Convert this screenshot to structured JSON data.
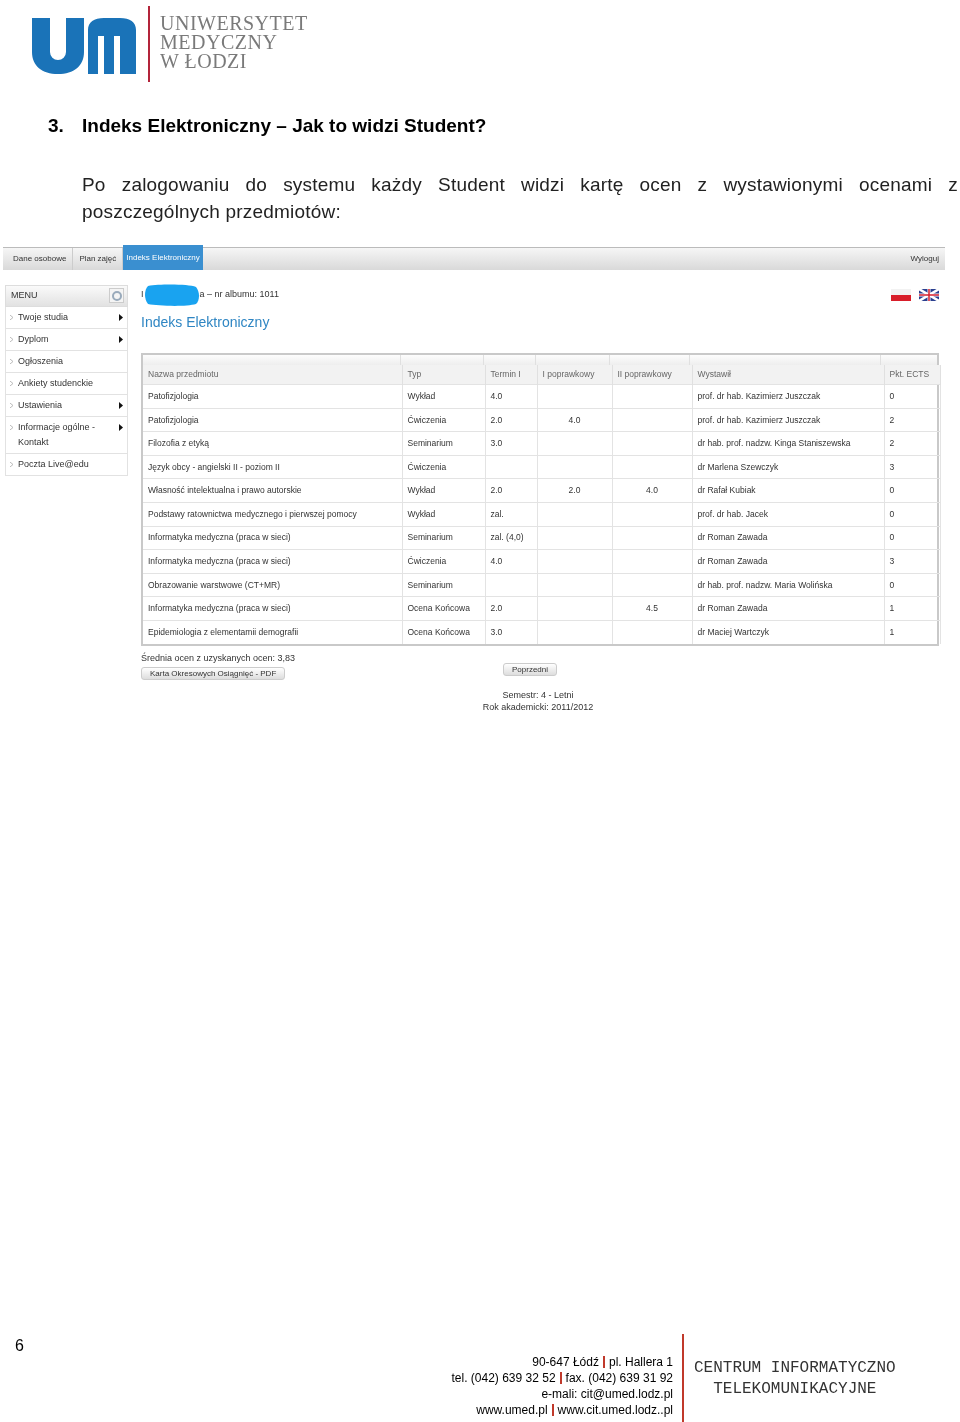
{
  "logo": {
    "lines": [
      "UNIWERSYTET",
      "MEDYCZNY",
      "W ŁODZI"
    ]
  },
  "heading": {
    "number": "3.",
    "text": "Indeks Elektroniczny – Jak to widzi Student?"
  },
  "intro": "Po zalogowaniu do systemu każdy Student widzi kartę ocen z wystawionymi ocenami z poszczególnych przedmiotów:",
  "screenshot": {
    "tabs": [
      {
        "label": "Dane osobowe",
        "selected": false
      },
      {
        "label": "Plan zajęć",
        "selected": false
      },
      {
        "label": "Indeks Elektroniczny",
        "selected": true
      }
    ],
    "logout": "Wyloguj",
    "menu": {
      "title": "MENU",
      "items": [
        {
          "label": "Twoje studia",
          "submenu": true
        },
        {
          "label": "Dyplom",
          "submenu": true
        },
        {
          "label": "Ogłoszenia",
          "submenu": false
        },
        {
          "label": "Ankiety studenckie",
          "submenu": false
        },
        {
          "label": "Ustawienia",
          "submenu": true
        },
        {
          "label": "Informacje ogólne - Kontakt",
          "submenu": true
        },
        {
          "label": "Poczta Live@edu",
          "submenu": false
        }
      ]
    },
    "student": {
      "prefix": "I",
      "suffix": "a – nr albumu: 1011"
    },
    "page_title": "Indeks Elektroniczny",
    "table": {
      "columns": [
        "Nazwa przedmiotu",
        "Typ",
        "Termin I",
        "I poprawkowy",
        "II poprawkowy",
        "Wystawił",
        "Pkt. ECTS"
      ],
      "rows": [
        [
          "Patofizjologia",
          "Wykład",
          "4.0",
          "",
          "",
          "prof. dr hab. Kazimierz Juszczak",
          "0"
        ],
        [
          "Patofizjologia",
          "Ćwiczenia",
          "2.0",
          "4.0",
          "",
          "prof. dr hab. Kazimierz Juszczak",
          "2"
        ],
        [
          "Filozofia z etyką",
          "Seminarium",
          "3.0",
          "",
          "",
          "dr hab. prof. nadzw. Kinga Staniszewska",
          "2"
        ],
        [
          "Język obcy - angielski II - poziom II",
          "Ćwiczenia",
          "",
          "",
          "",
          "dr Marlena Szewczyk",
          "3"
        ],
        [
          "Własność intelektualna i prawo autorskie",
          "Wykład",
          "2.0",
          "2.0",
          "4.0",
          "dr Rafał Kubiak",
          "0"
        ],
        [
          "Podstawy ratownictwa medycznego i pierwszej pomocy",
          "Wykład",
          "zal.",
          "",
          "",
          "prof. dr hab. Jacek",
          "0"
        ],
        [
          "Informatyka medyczna (praca w sieci)",
          "Seminarium",
          "zal. (4,0)",
          "",
          "",
          "dr Roman Zawada",
          "0"
        ],
        [
          "Informatyka medyczna (praca w sieci)",
          "Ćwiczenia",
          "4.0",
          "",
          "",
          "dr Roman Zawada",
          "3"
        ],
        [
          "Obrazowanie warstwowe (CT+MR)",
          "Seminarium",
          "",
          "",
          "",
          "dr hab. prof. nadzw. Maria Wolińska",
          "0"
        ],
        [
          "Informatyka medyczna (praca w sieci)",
          "Ocena Końcowa",
          "2.0",
          "",
          "4.5",
          "dr Roman Zawada",
          "1"
        ],
        [
          "Epidemiologia z elementamii demografii",
          "Ocena Końcowa",
          "3.0",
          "",
          "",
          "dr Maciej Wartczyk",
          "1"
        ]
      ]
    },
    "average": "Średnia ocen z uzyskanych ocen: 3,83",
    "pdf_button": "Karta Okresowych Osiągnięć - PDF",
    "prev_button": "Poprzedni",
    "semester": "Semestr: 4 - Letni",
    "year": "Rok akademicki: 2011/2012"
  },
  "page_number": "6",
  "footer": {
    "address": [
      [
        "90-647 Łódź",
        "pl. Hallera 1"
      ],
      [
        "tel. (042) 639 32 52",
        "fax. (042) 639 31 92"
      ],
      [
        "e-mali: cit@umed.lodz.pl"
      ],
      [
        "www.umed.pl",
        "www.cit.umed.lodz..pl"
      ]
    ],
    "unit": [
      "CENTRUM INFORMATYCZNO",
      "TELEKOMUNIKACYJNE"
    ]
  }
}
